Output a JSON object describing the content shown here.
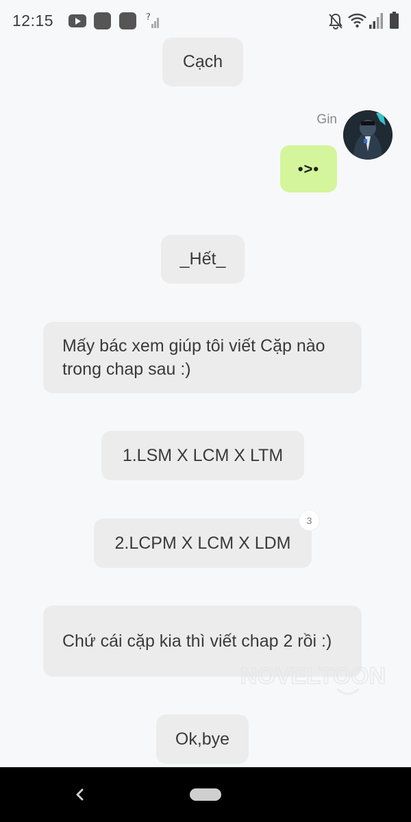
{
  "status_bar": {
    "time": "12:15",
    "left_icons": [
      "youtube-icon",
      "app-square-icon",
      "app-square-icon",
      "no-signal-icon"
    ],
    "right_icons": [
      "bell-off-icon",
      "wifi-icon",
      "cellular-signal-icon",
      "battery-icon"
    ]
  },
  "chat": {
    "messages": [
      {
        "text": "Cạch"
      },
      {
        "sender": "Gin",
        "text": "•>•",
        "avatar": "avatar-icon"
      },
      {
        "text": "_Hết_"
      },
      {
        "text": "Mấy bác xem giúp tôi viết Cặp nào trong chap sau :)"
      },
      {
        "text": "1.LSM X LCM X LTM"
      },
      {
        "text": "2.LCPM X LCM X LDM",
        "badge": "3"
      },
      {
        "text": "Chứ cái cặp kia thì viết chap 2 rồi :)"
      },
      {
        "text": "Ok,bye"
      }
    ]
  },
  "watermark": {
    "text": "NOVELTOON"
  },
  "nav_bar": {
    "icons": [
      "back-icon",
      "home-pill-icon"
    ]
  },
  "colors": {
    "background": "#f7f8fa",
    "bubble": "#ececec",
    "my_bubble": "#d4f59b",
    "text": "#3a3a3a",
    "nav_bar": "#000000"
  }
}
